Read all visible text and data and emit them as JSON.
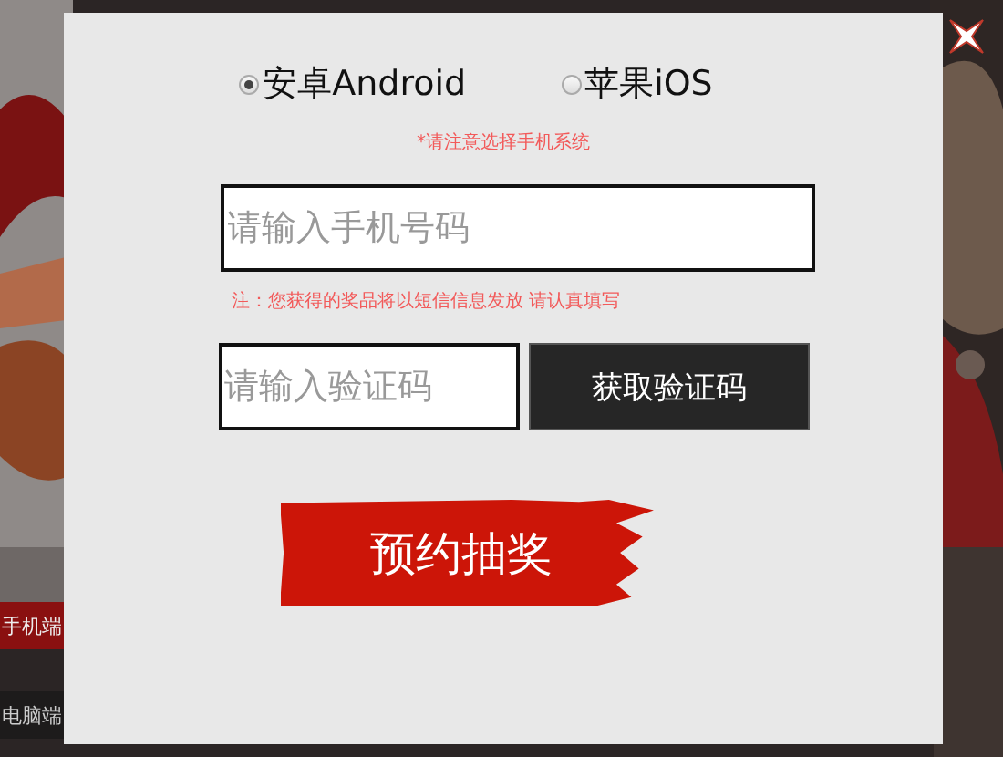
{
  "background": {
    "kind": "picture",
    "tabs": [
      {
        "label": "手机端",
        "selected": true
      },
      {
        "label": "电脑端",
        "selected": false
      }
    ]
  },
  "dialog": {
    "platforms": [
      {
        "label": "安卓Android",
        "selected": true
      },
      {
        "label": "苹果iOS",
        "selected": false
      }
    ],
    "platform_hint": "*请注意选择手机系统",
    "phone_field": {
      "placeholder": "请输入手机号码"
    },
    "notice": "注：您获得的奖品将以短信信息发放 请认真填写",
    "code_field": {
      "placeholder": "请输入验证码"
    },
    "code_button": "获取验证码",
    "submit_button": "预约抽奖"
  }
}
